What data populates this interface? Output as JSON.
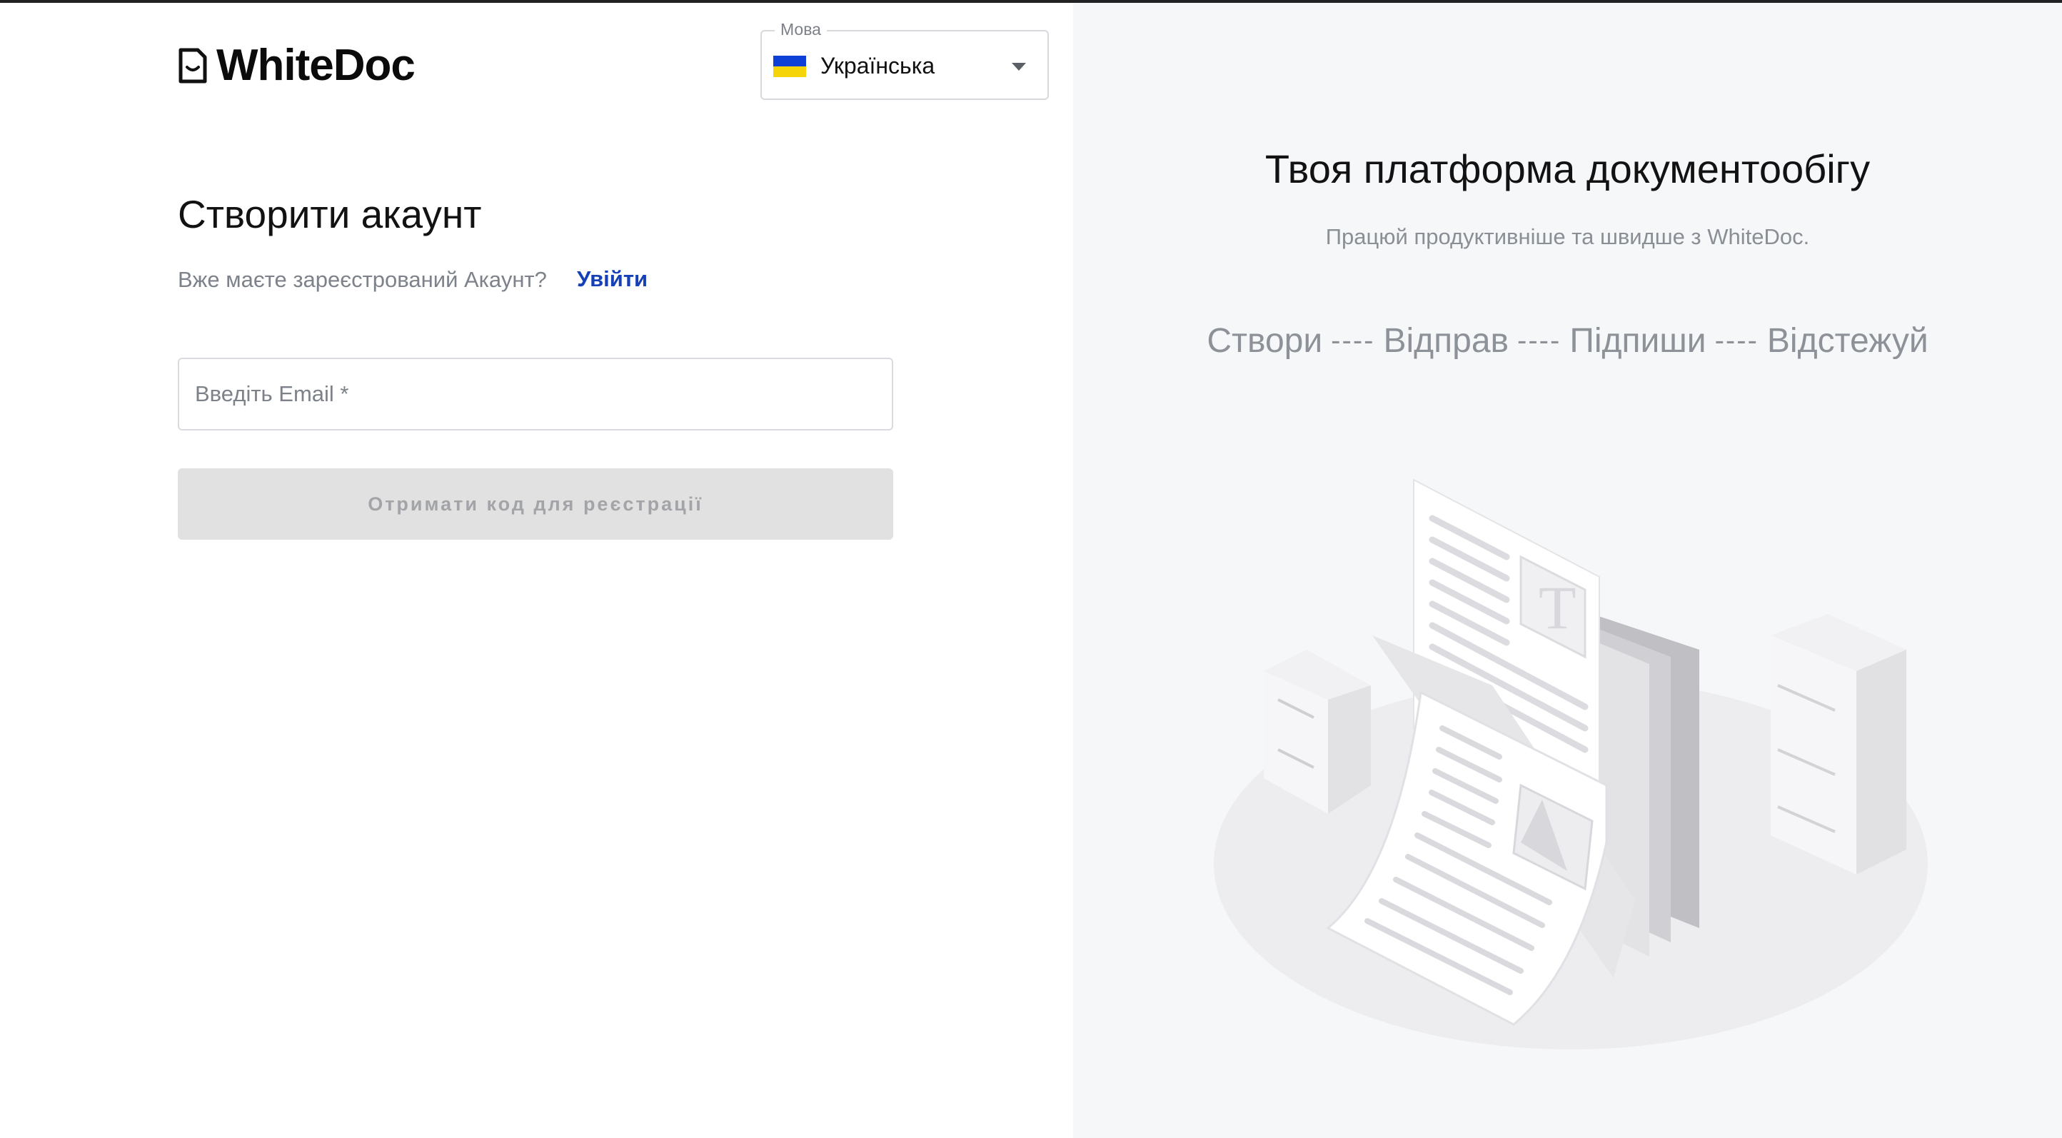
{
  "brand": {
    "name": "WhiteDoc"
  },
  "language": {
    "legend": "Мова",
    "selected": "Українська"
  },
  "signup": {
    "title": "Створити акаунт",
    "have_account_text": "Вже маєте зареєстрований Акаунт?",
    "login_link": "Увійти",
    "email_placeholder": "Введіть Email *",
    "submit_label": "Отримати код для реєстрації"
  },
  "promo": {
    "title": "Твоя платформа документообігу",
    "subtitle": "Працюй продуктивніше та швидше з WhiteDoc.",
    "steps": [
      "Створи",
      "Відправ",
      "Підпиши",
      "Відстежуй"
    ],
    "separator": "----"
  }
}
